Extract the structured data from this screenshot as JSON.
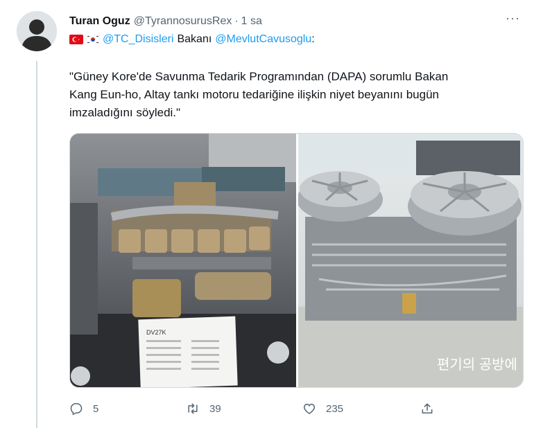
{
  "tweet": {
    "author_name": "Turan Oguz",
    "author_handle": "@TyrannosurusRex",
    "separator": "·",
    "time": "1 sa",
    "more_label": "···",
    "mention_1": "@TC_Disisleri",
    "word_1": "Bakanı",
    "mention_2": "@MevlutCavusoglu",
    "colon": ":",
    "quote_line_1": "\"Güney Kore'de Savunma Tedarik Programından (DAPA) sorumlu Bakan",
    "quote_line_2": "Kang Eun-ho, Altay tankı motoru tedariğine ilişkin niyet beyanını bugün",
    "quote_line_3": "imzaladığını söyledi.\"",
    "flags": [
      "turkey-flag",
      "south-korea-flag"
    ]
  },
  "media": {
    "left_placard_title": "DV27K",
    "right_watermark": "편기의 공방에"
  },
  "actions": {
    "reply_count": "5",
    "retweet_count": "39",
    "like_count": "235"
  },
  "colors": {
    "accent": "#1d9bf0",
    "secondary_text": "#536471",
    "divider": "#cfd9de"
  }
}
